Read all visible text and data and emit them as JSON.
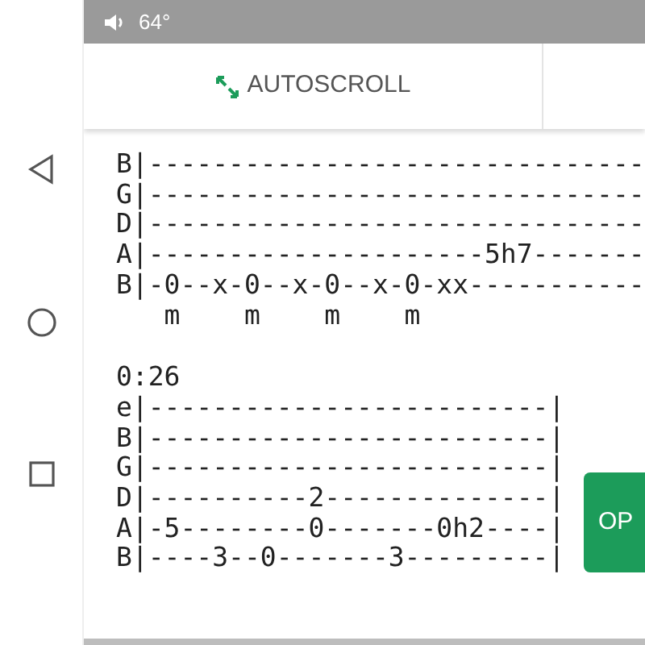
{
  "status_bar": {
    "temperature": "64°"
  },
  "toolbar": {
    "autoscroll_button": "AUTOSCROLL"
  },
  "tab_blocks": [
    {
      "lines": [
        "B|-------------------------------",
        "G|-------------------------------",
        "D|-------------------------------",
        "A|---------------------5h7-------",
        "B|-0--x-0--x-0--x-0-xx-----------",
        "   m    m    m    m"
      ]
    },
    {
      "time": "0:26",
      "lines": [
        "e|-------------------------|",
        "B|-------------------------|",
        "G|-------------------------|",
        "D|----------2--------------|",
        "A|-5--------0-------0h2----|",
        "B|----3--0-------3---------|"
      ]
    }
  ],
  "open_button": "OP"
}
